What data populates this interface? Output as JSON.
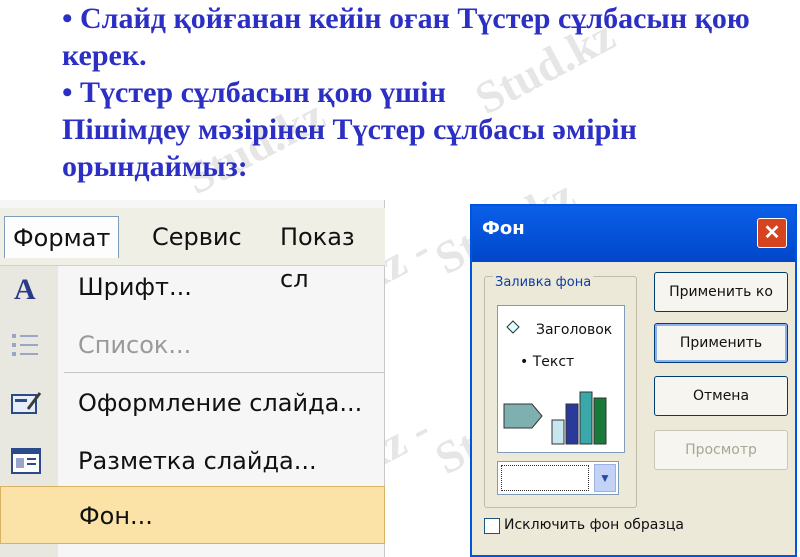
{
  "slide": {
    "bullet1": "• Слайд қойғанан кейін оған Түстер сұлбасын қою керек.",
    "bullet2": "• Түстер сұлбасын қою үшін",
    "line3": "Пішімдеу  мәзірінен Түстер сұлбасы әмірін орындаймыз:"
  },
  "watermark": "Stud.kz",
  "menubar": {
    "items": [
      "Формат",
      "Сервис",
      "Показ сл"
    ]
  },
  "format_menu": {
    "items": [
      {
        "label": "Шрифт...",
        "icon": "font-A-icon",
        "disabled": false
      },
      {
        "label": "Список...",
        "icon": "list-bullets-icon",
        "disabled": true
      },
      {
        "label": "Оформление слайда...",
        "icon": "slide-design-icon",
        "disabled": false
      },
      {
        "label": "Разметка слайда...",
        "icon": "slide-layout-icon",
        "disabled": false
      },
      {
        "label": "Фон...",
        "icon": "",
        "disabled": false,
        "highlighted": true
      }
    ]
  },
  "dialog": {
    "title": "Фон",
    "group_label": "Заливка фона",
    "preview_title": "Заголовок",
    "preview_text": "• Текст",
    "buttons": {
      "apply_all": "Применить ко всем",
      "apply": "Применить",
      "cancel": "Отмена",
      "preview": "Просмотр"
    },
    "checkbox_label": "Исключить фон образца",
    "checkbox_checked": false
  },
  "colors": {
    "slide_text": "#2b2fc4",
    "titlebar": "#0a5fe8",
    "highlight": "#fbe3a8"
  }
}
